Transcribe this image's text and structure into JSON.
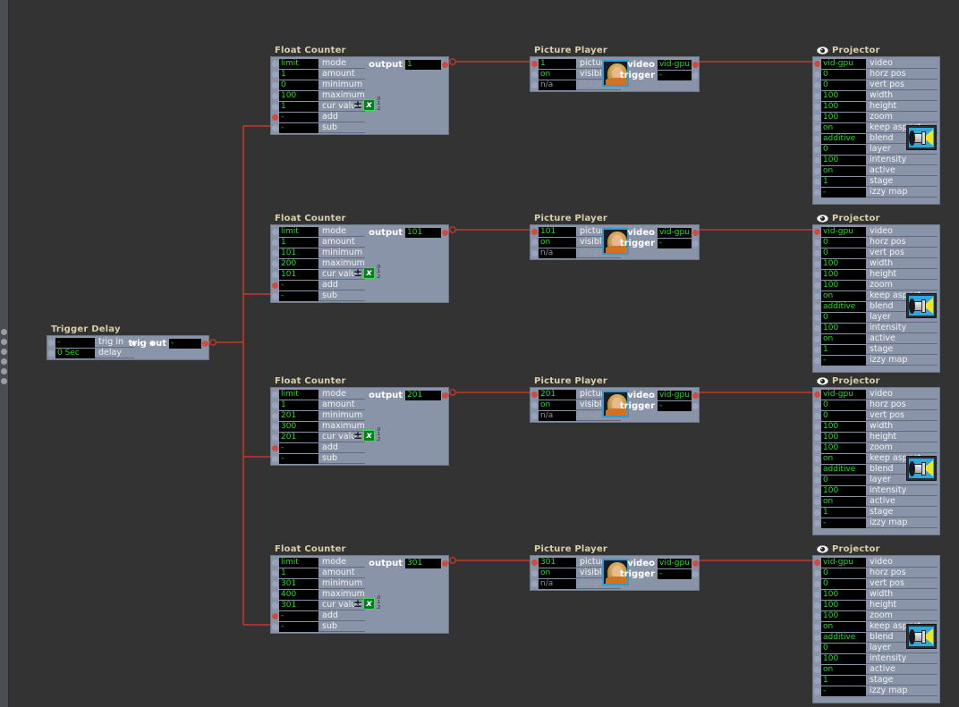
{
  "app": {
    "canvas_background": "#333333",
    "wire_color": "#c0392b",
    "node_body_color": "#8a94a8",
    "value_text_color": "#22dd22",
    "title_color": "#d9cfa8"
  },
  "edge_strip": {
    "dot_count": 6
  },
  "trigger_delay": {
    "title": "Trigger Delay",
    "rows": [
      {
        "value": "-",
        "label": "trig in"
      },
      {
        "value": "0 Sec",
        "label": "delay"
      }
    ],
    "output_label": "trig out",
    "output_value": "-",
    "icon": "sparkle-icon"
  },
  "labels": {
    "float_counter_title": "Float Counter",
    "picture_player_title": "Picture Player",
    "projector_title": "Projector",
    "fc_rows": [
      "mode",
      "amount",
      "minimum",
      "maximum",
      "cur value",
      "add",
      "sub"
    ],
    "fc_output_label": "output",
    "pp_rows": [
      "picture",
      "visible",
      "stage"
    ],
    "pp_video_label": "video",
    "pp_trigger_label": "trigger",
    "pj_rows": [
      "video",
      "horz pos",
      "vert pos",
      "width",
      "height",
      "zoom",
      "keep aspect",
      "blend",
      "layer",
      "intensity",
      "active",
      "stage",
      "izzy map"
    ],
    "pm_sign": "±",
    "pm_x": "x",
    "pm_decimals": [
      ".0",
      ".1",
      ".2"
    ]
  },
  "chains": [
    {
      "counter": {
        "mode": "limit",
        "amount": "1",
        "minimum": "0",
        "maximum": "100",
        "cur_value": "1",
        "add": "-",
        "sub": "-",
        "output": "1"
      },
      "player": {
        "picture": "1",
        "visible": "on",
        "stage": "n/a",
        "video": "vid-gpu",
        "trigger": "-"
      },
      "projector": {
        "video": "vid-gpu",
        "horz_pos": "0",
        "vert_pos": "0",
        "width": "100",
        "height": "100",
        "zoom": "100",
        "keep_aspect": "on",
        "blend": "additive",
        "layer": "0",
        "intensity": "100",
        "active": "on",
        "stage": "1",
        "izzy_map": "-"
      }
    },
    {
      "counter": {
        "mode": "limit",
        "amount": "1",
        "minimum": "101",
        "maximum": "200",
        "cur_value": "101",
        "add": "-",
        "sub": "-",
        "output": "101"
      },
      "player": {
        "picture": "101",
        "visible": "on",
        "stage": "n/a",
        "video": "vid-gpu",
        "trigger": "-"
      },
      "projector": {
        "video": "vid-gpu",
        "horz_pos": "0",
        "vert_pos": "0",
        "width": "100",
        "height": "100",
        "zoom": "100",
        "keep_aspect": "on",
        "blend": "additive",
        "layer": "0",
        "intensity": "100",
        "active": "on",
        "stage": "1",
        "izzy_map": "-"
      }
    },
    {
      "counter": {
        "mode": "limit",
        "amount": "1",
        "minimum": "201",
        "maximum": "300",
        "cur_value": "201",
        "add": "-",
        "sub": "-",
        "output": "201"
      },
      "player": {
        "picture": "201",
        "visible": "on",
        "stage": "n/a",
        "video": "vid-gpu",
        "trigger": "-"
      },
      "projector": {
        "video": "vid-gpu",
        "horz_pos": "0",
        "vert_pos": "0",
        "width": "100",
        "height": "100",
        "zoom": "100",
        "keep_aspect": "on",
        "blend": "additive",
        "layer": "0",
        "intensity": "100",
        "active": "on",
        "stage": "1",
        "izzy_map": "-"
      }
    },
    {
      "counter": {
        "mode": "limit",
        "amount": "1",
        "minimum": "301",
        "maximum": "400",
        "cur_value": "301",
        "add": "-",
        "sub": "-",
        "output": "301"
      },
      "player": {
        "picture": "301",
        "visible": "on",
        "stage": "n/a",
        "video": "vid-gpu",
        "trigger": "-"
      },
      "projector": {
        "video": "vid-gpu",
        "horz_pos": "0",
        "vert_pos": "0",
        "width": "100",
        "height": "100",
        "zoom": "100",
        "keep_aspect": "on",
        "blend": "additive",
        "layer": "0",
        "intensity": "100",
        "active": "on",
        "stage": "1",
        "izzy_map": "-"
      }
    }
  ]
}
